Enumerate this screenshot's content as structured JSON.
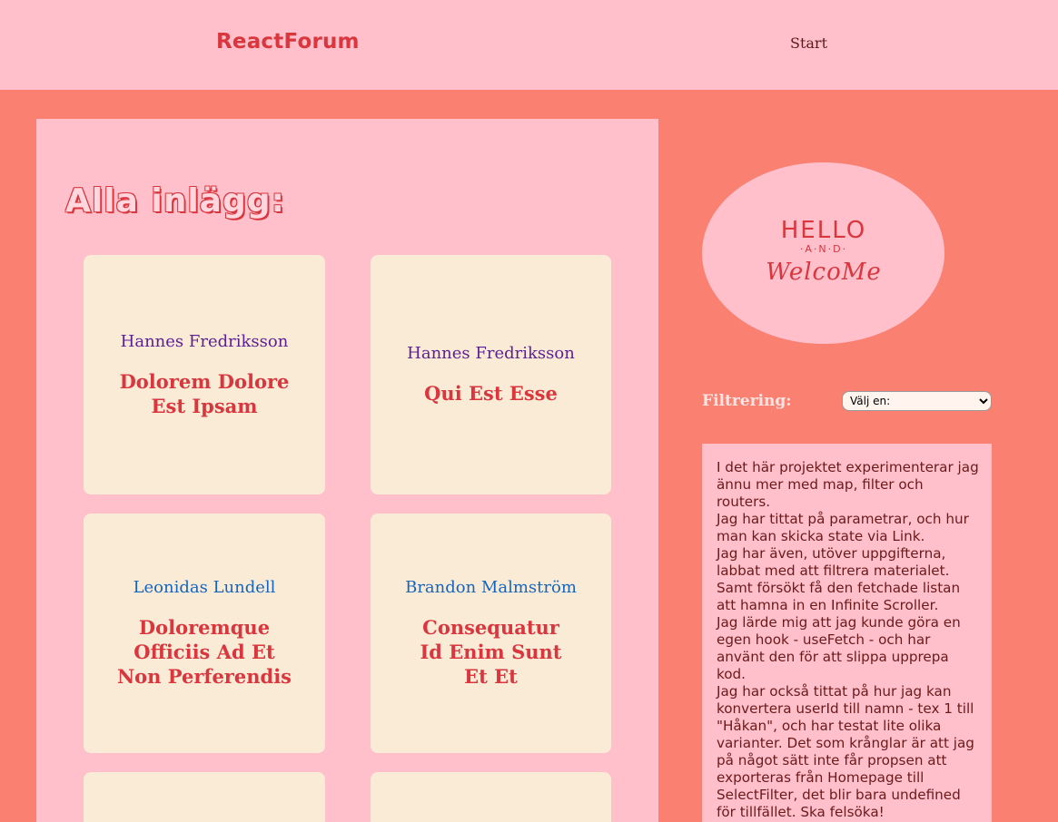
{
  "header": {
    "brand": "ReactForum",
    "nav_start": "Start"
  },
  "main": {
    "title": "Alla inlägg:",
    "posts": [
      {
        "author": "Hannes Fredriksson",
        "title": "Dolorem Dolore Est Ipsam"
      },
      {
        "author": "Hannes Fredriksson",
        "title": "Qui Est Esse"
      },
      {
        "author": "Leonidas Lundell",
        "title": "Doloremque Officiis Ad Et Non Perferendis"
      },
      {
        "author": "Brandon Malmström",
        "title": "Consequatur Id Enim Sunt Et Et"
      }
    ]
  },
  "sidebar": {
    "welcome": {
      "line1": "HELLO",
      "line2": "·A·N·D·",
      "line3": "WelcoMe"
    },
    "filter_label": "Filtrering:",
    "filter_selected": "Välj en:",
    "info_paragraphs": [
      "I det här projektet experimenterar jag ännu mer med map, filter och routers.",
      "Jag har tittat på parametrar, och hur man kan skicka state via Link.",
      "Jag har även, utöver uppgifterna, labbat med att filtrera materialet.",
      "Samt försökt få den fetchade listan att hamna in en Infinite Scroller.",
      "Jag lärde mig att jag kunde göra en egen hook - useFetch - och har använt den för att slippa upprepa kod.",
      "Jag har också tittat på hur jag kan konvertera userId till namn - tex 1 till \"Håkan\", och har testat lite olika varianter. Det som krånglar är att jag på något sätt inte får propsen att exporteras från Homepage till SelectFilter, det blir bara undefined för tillfället. Ska felsöka!"
    ]
  },
  "colors": {
    "background": "#fa8072",
    "panel": "#ffc0cb",
    "card": "#faebd7",
    "accent": "#d9363e"
  }
}
